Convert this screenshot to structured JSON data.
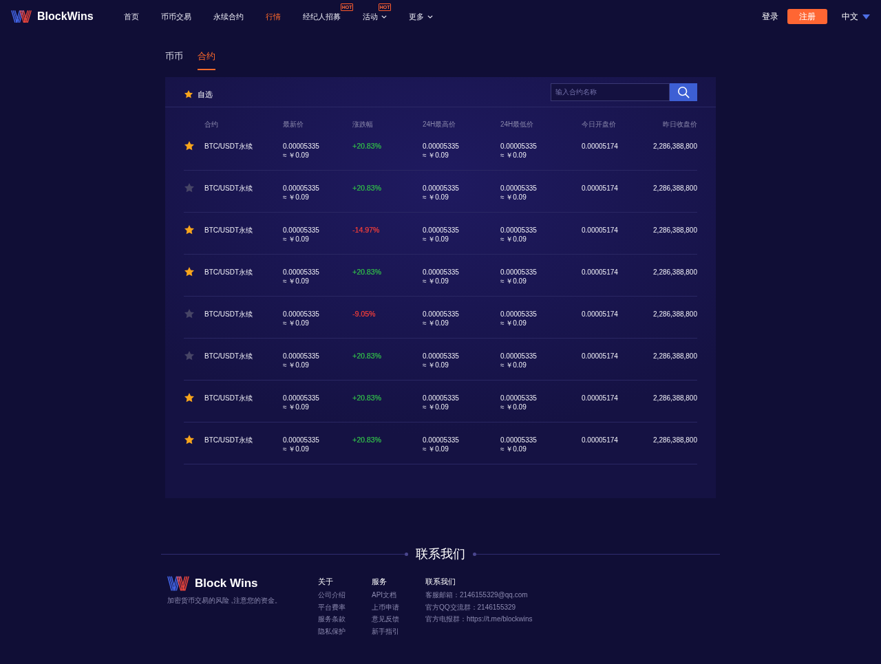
{
  "header": {
    "brand": "BlockWins",
    "nav": [
      {
        "label": "首页",
        "selected": false,
        "dropdown": false
      },
      {
        "label": "币币交易",
        "selected": false,
        "dropdown": false
      },
      {
        "label": "永续合约",
        "selected": false,
        "dropdown": false
      },
      {
        "label": "行情",
        "selected": true,
        "dropdown": false
      },
      {
        "label": "经纪人招募",
        "selected": false,
        "dropdown": false,
        "badge": "HOT"
      },
      {
        "label": "活动",
        "selected": false,
        "dropdown": true,
        "badge": "HOT"
      },
      {
        "label": "更多",
        "selected": false,
        "dropdown": true
      }
    ],
    "login": "登录",
    "register": "注册",
    "language": "中文"
  },
  "tabs": [
    {
      "label": "币币",
      "selected": false
    },
    {
      "label": "合约",
      "selected": true
    }
  ],
  "market": {
    "favorites": "自选",
    "search": {
      "placeholder": "输入合约名称"
    },
    "columns": [
      "合约",
      "最新价",
      "涨跌幅",
      "24H最高价",
      "24H最低价",
      "今日开盘价",
      "昨日收盘价"
    ],
    "rows": [
      {
        "starred": true,
        "contract": "BTC/USDT永续",
        "last_price": "0.00005335",
        "last_price_cny": "≈ ￥0.09",
        "change": {
          "text": "+20.83%",
          "color": "#2fae4a"
        },
        "high": "0.00005335",
        "high_cny": "≈ ￥0.09",
        "low": "0.00005335",
        "low_cny": "≈ ￥0.09",
        "open": "0.00005174",
        "prev_close": "2,286,388,800"
      },
      {
        "starred": false,
        "contract": "BTC/USDT永续",
        "last_price": "0.00005335",
        "last_price_cny": "≈ ￥0.09",
        "change": {
          "text": "+20.83%",
          "color": "#2fae4a"
        },
        "high": "0.00005335",
        "high_cny": "≈ ￥0.09",
        "low": "0.00005335",
        "low_cny": "≈ ￥0.09",
        "open": "0.00005174",
        "prev_close": "2,286,388,800"
      },
      {
        "starred": true,
        "contract": "BTC/USDT永续",
        "last_price": "0.00005335",
        "last_price_cny": "≈ ￥0.09",
        "change": {
          "text": "-14.97%",
          "color": "#e23b3b"
        },
        "high": "0.00005335",
        "high_cny": "≈ ￥0.09",
        "low": "0.00005335",
        "low_cny": "≈ ￥0.09",
        "open": "0.00005174",
        "prev_close": "2,286,388,800"
      },
      {
        "starred": true,
        "contract": "BTC/USDT永续",
        "last_price": "0.00005335",
        "last_price_cny": "≈ ￥0.09",
        "change": {
          "text": "+20.83%",
          "color": "#2fae4a"
        },
        "high": "0.00005335",
        "high_cny": "≈ ￥0.09",
        "low": "0.00005335",
        "low_cny": "≈ ￥0.09",
        "open": "0.00005174",
        "prev_close": "2,286,388,800"
      },
      {
        "starred": false,
        "contract": "BTC/USDT永续",
        "last_price": "0.00005335",
        "last_price_cny": "≈ ￥0.09",
        "change": {
          "text": "-9.05%",
          "color": "#e23b3b"
        },
        "high": "0.00005335",
        "high_cny": "≈ ￥0.09",
        "low": "0.00005335",
        "low_cny": "≈ ￥0.09",
        "open": "0.00005174",
        "prev_close": "2,286,388,800"
      },
      {
        "starred": false,
        "contract": "BTC/USDT永续",
        "last_price": "0.00005335",
        "last_price_cny": "≈ ￥0.09",
        "change": {
          "text": "+20.83%",
          "color": "#2fae4a"
        },
        "high": "0.00005335",
        "high_cny": "≈ ￥0.09",
        "low": "0.00005335",
        "low_cny": "≈ ￥0.09",
        "open": "0.00005174",
        "prev_close": "2,286,388,800"
      },
      {
        "starred": true,
        "contract": "BTC/USDT永续",
        "last_price": "0.00005335",
        "last_price_cny": "≈ ￥0.09",
        "change": {
          "text": "+20.83%",
          "color": "#2fae4a"
        },
        "high": "0.00005335",
        "high_cny": "≈ ￥0.09",
        "low": "0.00005335",
        "low_cny": "≈ ￥0.09",
        "open": "0.00005174",
        "prev_close": "2,286,388,800"
      },
      {
        "starred": true,
        "contract": "BTC/USDT永续",
        "last_price": "0.00005335",
        "last_price_cny": "≈ ￥0.09",
        "change": {
          "text": "+20.83%",
          "color": "#2fae4a"
        },
        "high": "0.00005335",
        "high_cny": "≈ ￥0.09",
        "low": "0.00005335",
        "low_cny": "≈ ￥0.09",
        "open": "0.00005174",
        "prev_close": "2,286,388,800"
      }
    ]
  },
  "footer": {
    "title": "联系我们",
    "brand": "Block Wins",
    "tagline": "加密货币交易的风险 ,注意您的资金。",
    "columns": [
      {
        "kind": "links",
        "heading": "关于",
        "items": [
          "公司介绍",
          "平台费率",
          "服务条款",
          "隐私保护"
        ]
      },
      {
        "kind": "links",
        "heading": "服务",
        "items": [
          "API文档",
          "上币申请",
          "意见反馈",
          "新手指引"
        ]
      },
      {
        "kind": "contact",
        "heading": "联系我们",
        "items": [
          "客服邮箱：2146155329@qq.com",
          "官方QQ交流群：2146155329",
          "官方电报群：https://t.me/blockwins"
        ]
      }
    ]
  }
}
